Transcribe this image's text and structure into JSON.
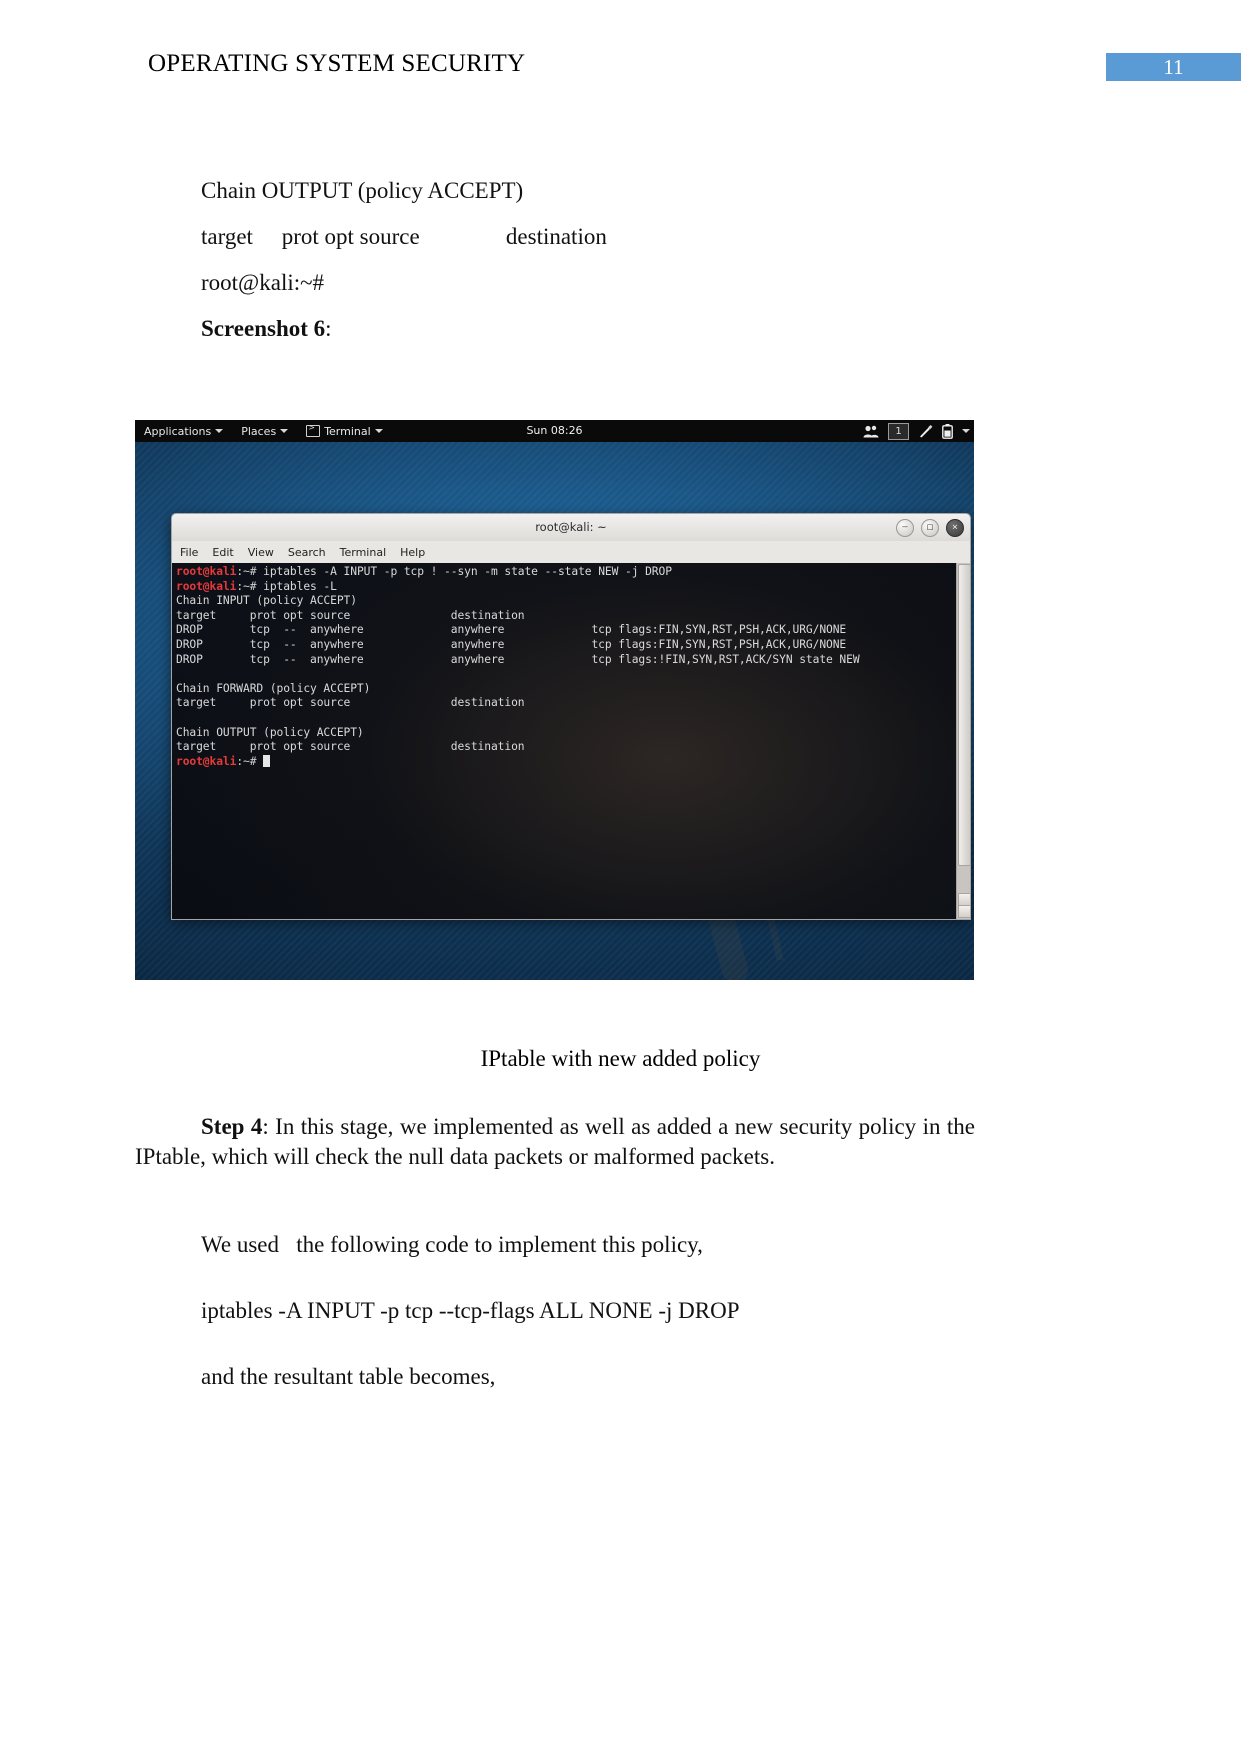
{
  "header": {
    "title": "OPERATING SYSTEM SECURITY",
    "page_number": "11",
    "badge_color": "#5b9bd5"
  },
  "body": {
    "line1": "Chain OUTPUT (policy ACCEPT)",
    "line2": "target     prot opt source               destination",
    "line3": "root@kali:~#",
    "screenshot_label": "Screenshot 6",
    "screenshot_label_colon": ":",
    "caption": "IPtable with new added policy",
    "step4_label": "Step 4",
    "step4_text": ":  In this stage, we implemented as well as added a new security policy in the IPtable, which will check the null data packets or malformed packets.",
    "para_used": "We used   the following code to implement this policy,",
    "para_code": "iptables -A INPUT -p tcp --tcp-flags ALL NONE -j DROP",
    "para_result": "and the resultant table becomes,"
  },
  "screenshot": {
    "panel": {
      "applications": "Applications",
      "places": "Places",
      "terminal": "Terminal",
      "clock": "Sun 08:26",
      "workspace": "1"
    },
    "window": {
      "title": "root@kali: ~",
      "menus": [
        "File",
        "Edit",
        "View",
        "Search",
        "Terminal",
        "Help"
      ]
    },
    "terminal_lines": [
      {
        "prompt": "root@kali",
        "path": ":~# ",
        "text": "iptables -A INPUT -p tcp ! --syn -m state --state NEW -j DROP"
      },
      {
        "prompt": "root@kali",
        "path": ":~# ",
        "text": "iptables -L"
      },
      {
        "text": "Chain INPUT (policy ACCEPT)"
      },
      {
        "text": "target     prot opt source               destination"
      },
      {
        "text": "DROP       tcp  --  anywhere             anywhere             tcp flags:FIN,SYN,RST,PSH,ACK,URG/NONE"
      },
      {
        "text": "DROP       tcp  --  anywhere             anywhere             tcp flags:FIN,SYN,RST,PSH,ACK,URG/NONE"
      },
      {
        "text": "DROP       tcp  --  anywhere             anywhere             tcp flags:!FIN,SYN,RST,ACK/SYN state NEW"
      },
      {
        "text": ""
      },
      {
        "text": "Chain FORWARD (policy ACCEPT)"
      },
      {
        "text": "target     prot opt source               destination"
      },
      {
        "text": ""
      },
      {
        "text": "Chain OUTPUT (policy ACCEPT)"
      },
      {
        "text": "target     prot opt source               destination"
      },
      {
        "prompt": "root@kali",
        "path": ":~# ",
        "text": "",
        "cursor": true
      }
    ]
  }
}
